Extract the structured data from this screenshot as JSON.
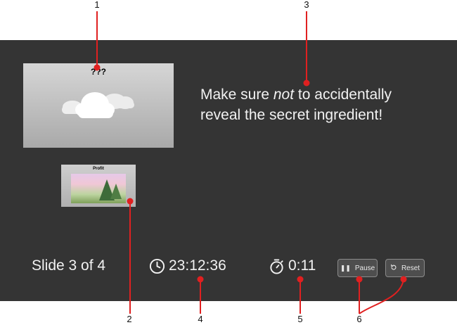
{
  "callouts": [
    "1",
    "2",
    "3",
    "4",
    "5",
    "6"
  ],
  "current_slide": {
    "title": "???",
    "image": "cloud-illustration"
  },
  "next_slide": {
    "title": "Profit",
    "image": "landscape-photo"
  },
  "notes": {
    "part1": "Make sure ",
    "emphasis": "not",
    "part2": " to accidentally reveal the secret ingredient!"
  },
  "footer": {
    "slide_counter": "Slide 3 of 4",
    "clock_icon": "clock-icon",
    "clock": "23:12:36",
    "timer_icon": "stopwatch-icon",
    "timer": "0:11",
    "pause_label": "Pause",
    "reset_label": "Reset"
  },
  "colors": {
    "background": "#343434",
    "callout": "#e02020",
    "text": "#f2f2f2"
  }
}
